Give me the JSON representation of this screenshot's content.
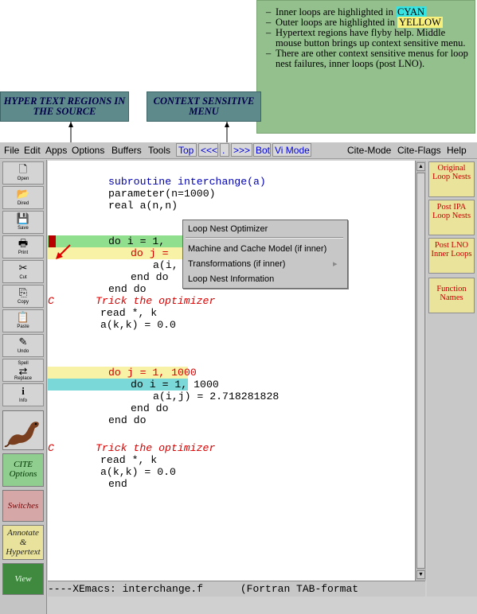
{
  "note": {
    "bullet1_prefix": "Inner loops are highlighted in",
    "bullet1_color": "CYAN",
    "bullet2_prefix": "Outer loops are highlighted in",
    "bullet2_color": "YELLOW",
    "bullet3": "Hypertext regions have flyby help. Middle mouse button brings up context sensitive menu.",
    "bullet4": "There are other context sensitive menus for loop nest failures, inner loops (post LNO)."
  },
  "callouts": {
    "hypertext": "HYPER TEXT  REGIONS IN THE SOURCE",
    "context": "CONTEXT SENSITIVE MENU"
  },
  "menubar": {
    "items": [
      "File",
      "Edit",
      "Apps",
      "Options",
      "Buffers",
      "Tools"
    ],
    "buttons": [
      "Top",
      "<<<",
      ".",
      ">>>",
      "Bot",
      "Vi Mode"
    ],
    "right_items": [
      "Cite-Mode",
      "Cite-Flags",
      "Help"
    ]
  },
  "toolbar": {
    "buttons": [
      "Open",
      "Dired",
      "Save",
      "Print",
      "Cut",
      "Copy",
      "Paste",
      "Undo",
      "Spell",
      "Replace",
      "Info"
    ],
    "extra": {
      "cite_options": "CITE Options",
      "switches": "Switches",
      "annotate": "Annotate & Hypertext",
      "view": "View"
    }
  },
  "code": {
    "l1": "subroutine interchange(a)",
    "l2": "parameter(n=1000)",
    "l3": "real a(n,n)",
    "l4": "do i = 1,",
    "l5": "do j =",
    "l6": "a(i,",
    "l7": "end do",
    "l8": "end do",
    "l9_c": "C",
    "l9": "Trick the optimizer",
    "l10": "read *, k",
    "l11": "a(k,k) = 0.0",
    "l12": "do j = 1, 1000",
    "l13": "do i = 1, 1000",
    "l14": "a(i,j) = 2.718281828",
    "l15": "end do",
    "l16": "end do",
    "l17_c": "C",
    "l17": "Trick the optimizer",
    "l18": "read *, k",
    "l19": "a(k,k) = 0.0",
    "l20": "end"
  },
  "context_menu": {
    "title": "Loop Nest Optimizer",
    "items": [
      "Machine and Cache Model (if inner)",
      "Transformations (if inner)",
      "Loop Nest Information"
    ],
    "submenu_arrow": "▸"
  },
  "right_panel": {
    "buttons": [
      "Original Loop Nests",
      "Post IPA Loop Nests",
      "Post LNO Inner Loops",
      "Function Names"
    ]
  },
  "modeline": "----XEmacs: interchange.f      (Fortran TAB-format",
  "colors": {
    "cyan_highlight": "#7ad8d8",
    "yellow_highlight": "#f7f2a6",
    "green_highlight": "#8fdf8f",
    "loop_red": "#d60000",
    "keyword_blue": "#0000b4"
  }
}
